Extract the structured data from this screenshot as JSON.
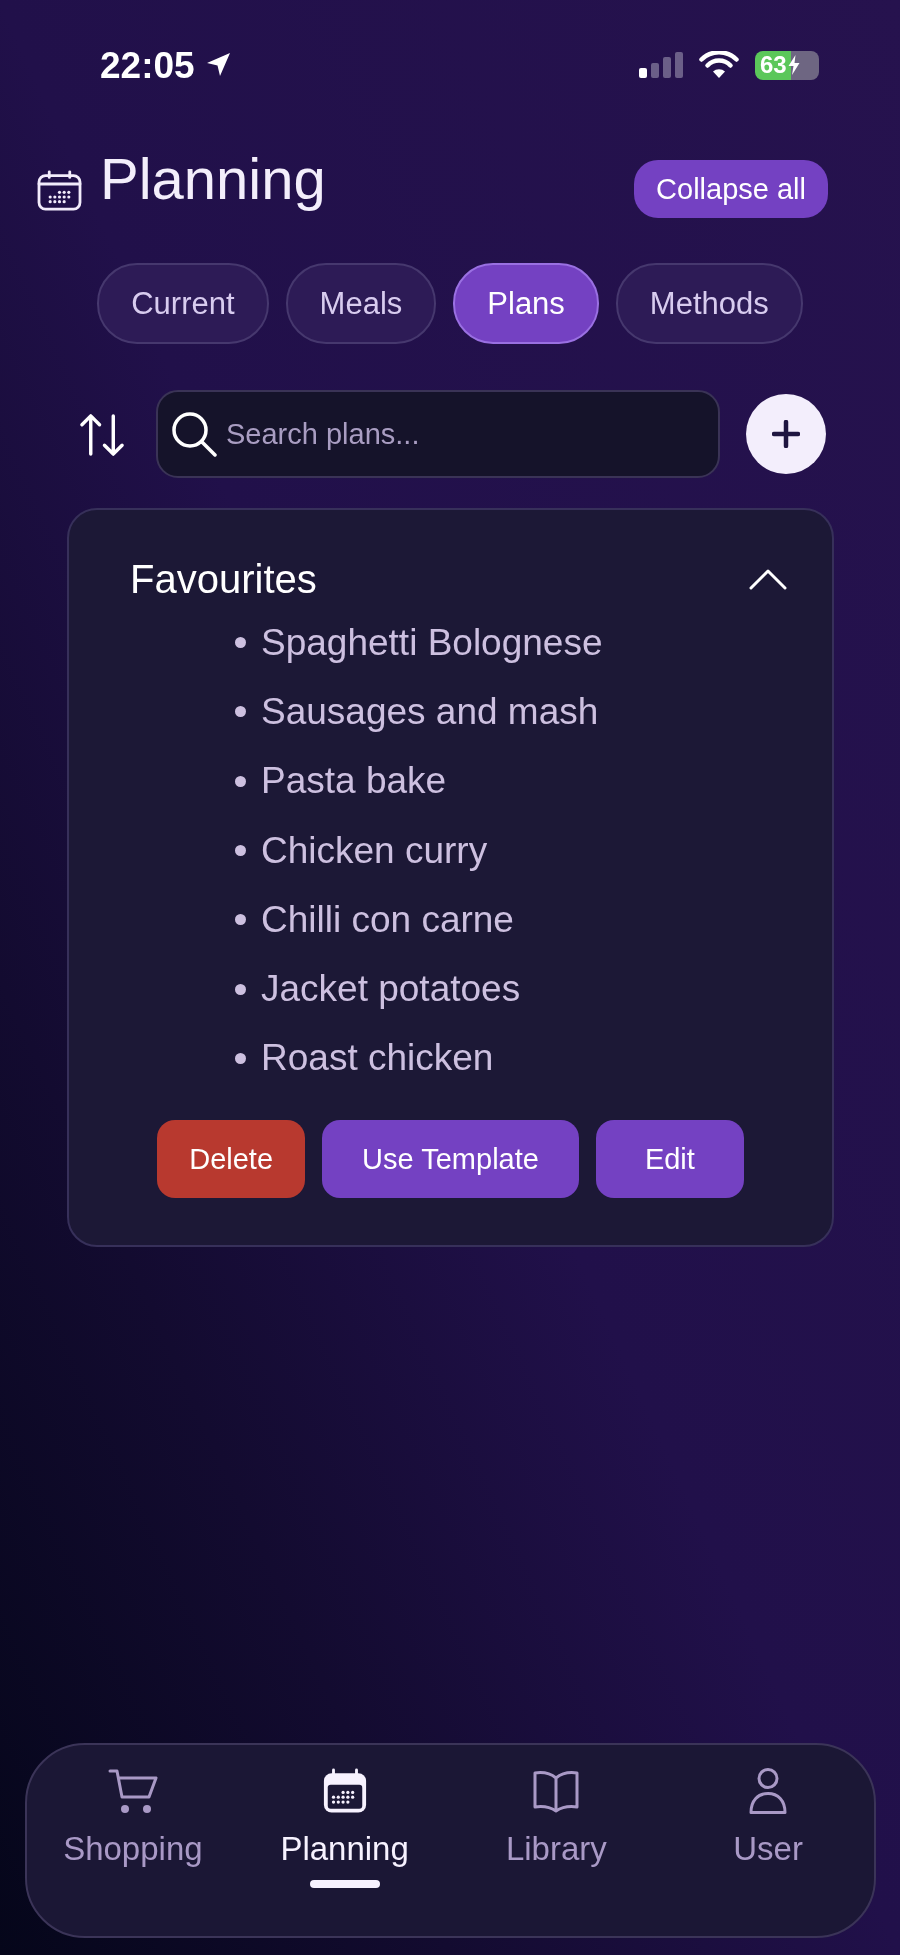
{
  "status_bar": {
    "time": "22:05",
    "battery": "63",
    "charging": true
  },
  "header": {
    "title": "Planning",
    "collapse_button": "Collapse all"
  },
  "tabs": [
    {
      "label": "Current",
      "selected": false
    },
    {
      "label": "Meals",
      "selected": false
    },
    {
      "label": "Plans",
      "selected": true
    },
    {
      "label": "Methods",
      "selected": false
    }
  ],
  "search": {
    "placeholder": "Search plans..."
  },
  "plans": [
    {
      "title": "Favourites",
      "expanded": true,
      "meals": [
        "Spaghetti Bolognese",
        "Sausages and mash",
        "Pasta bake",
        "Chicken curry",
        "Chilli con carne",
        "Jacket potatoes",
        "Roast chicken"
      ],
      "actions": [
        {
          "label": "Delete",
          "kind": "danger"
        },
        {
          "label": "Use Template",
          "kind": "primary"
        },
        {
          "label": "Edit",
          "kind": "primary"
        }
      ]
    }
  ],
  "bottom_nav": [
    {
      "label": "Shopping",
      "selected": false
    },
    {
      "label": "Planning",
      "selected": true
    },
    {
      "label": "Library",
      "selected": false
    },
    {
      "label": "User",
      "selected": false
    }
  ]
}
